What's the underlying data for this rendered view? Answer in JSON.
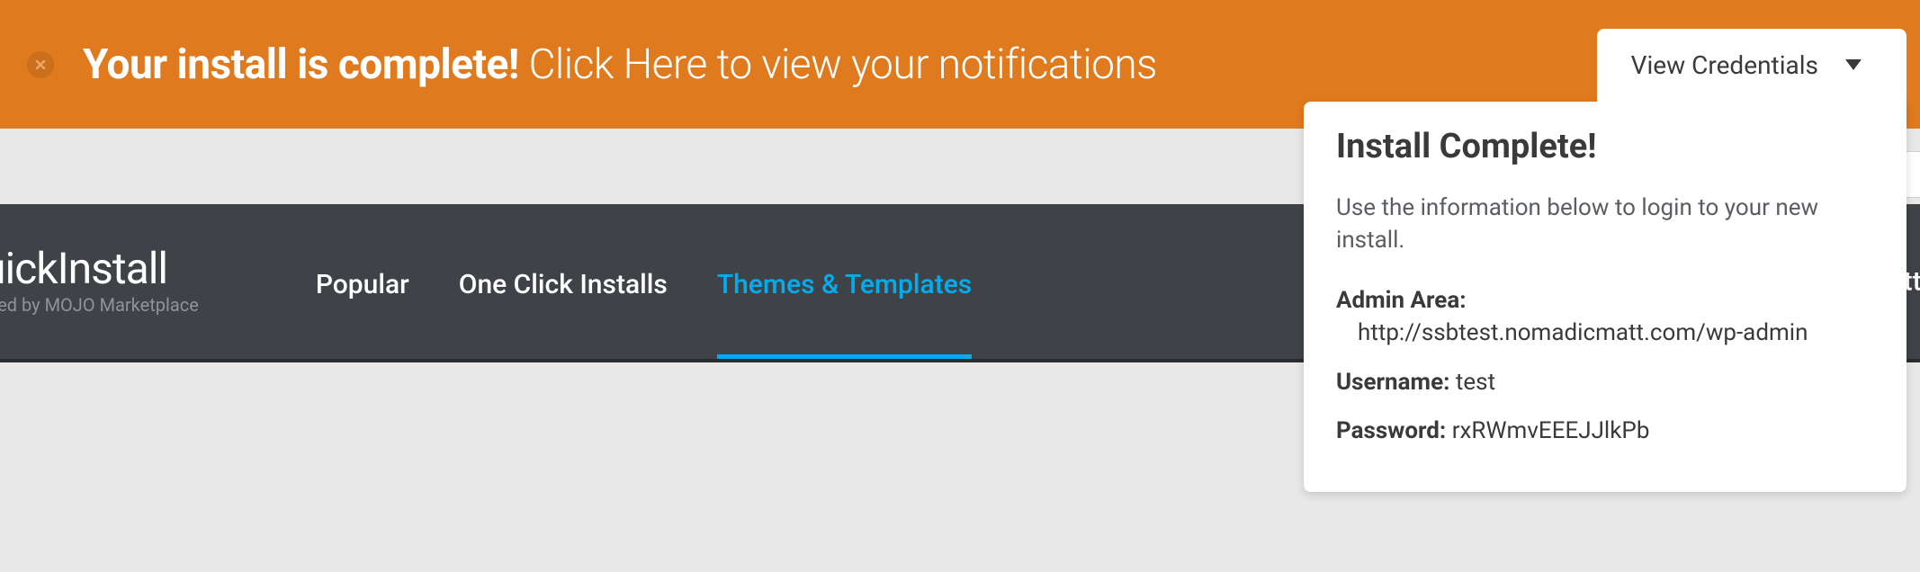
{
  "notification": {
    "bold_text": "Your install is complete!",
    "normal_text": "Click Here to view your notifications"
  },
  "credentials_tab": {
    "label": "View Credentials"
  },
  "credentials_panel": {
    "heading": "Install Complete!",
    "instructions": "Use the information below to login to your new install.",
    "admin_area_label": "Admin Area:",
    "admin_area_url": "http://ssbtest.nomadicmatt.com/wp-admin",
    "username_label": "Username:",
    "username_value": "test",
    "password_label": "Password:",
    "password_value": "rxRWmvEEEJJlkPb"
  },
  "brand": {
    "title": "uickInstall",
    "subtitle": "ered by MOJO Marketplace"
  },
  "nav": {
    "items": [
      {
        "label": "Popular"
      },
      {
        "label": "One Click Installs"
      },
      {
        "label": "Themes & Templates"
      }
    ]
  },
  "right_text": "iatt."
}
